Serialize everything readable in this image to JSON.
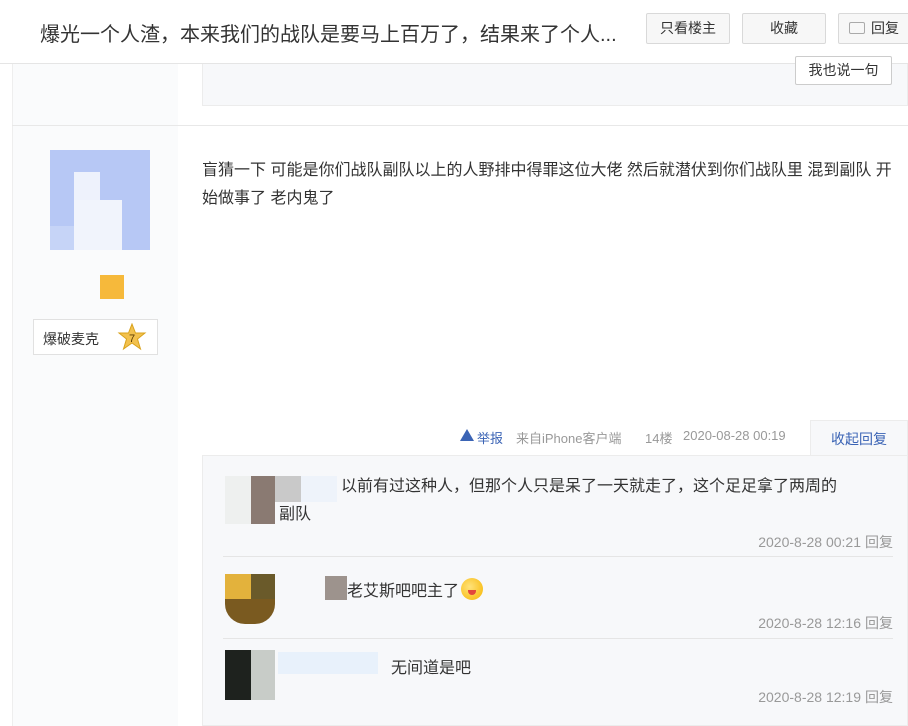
{
  "header": {
    "title": "爆光一个人渣，本来我们的战队是要马上百万了，结果来了个人...",
    "only_owner_label": "只看楼主",
    "favorite_label": "收藏",
    "reply_label": "回复"
  },
  "prev_floor": {
    "say_something_label": "我也说一句"
  },
  "user": {
    "name": "爆破麦克",
    "level": "7"
  },
  "post": {
    "content": "盲猜一下 可能是你们战队副队以上的人野排中得罪这位大佬 然后就潜伏到你们战队里 混到副队 开始做事了 老内鬼了",
    "report_label": "举报",
    "source": "来自iPhone客户端",
    "floor": "14楼",
    "time": "2020-08-28 00:19",
    "collapse_label": "收起回复"
  },
  "comments": [
    {
      "text_line1": "以前有过这种人，但那个人只是呆了一天就走了，这个足足拿了两周的",
      "text_line2": "副队",
      "time": "2020-8-28 00:21",
      "reply_label": "回复"
    },
    {
      "text": "老艾斯吧吧主了",
      "emoji": "tongue-out-emoji",
      "time": "2020-8-28 12:16",
      "reply_label": "回复"
    },
    {
      "text": "无间道是吧",
      "time": "2020-8-28 12:19",
      "reply_label": "回复"
    }
  ],
  "colors": {
    "link_blue": "#3b64b5",
    "muted_gray": "#999999",
    "avatar_blue": "#b7c8f5",
    "badge_gold": "#f6b93b"
  }
}
